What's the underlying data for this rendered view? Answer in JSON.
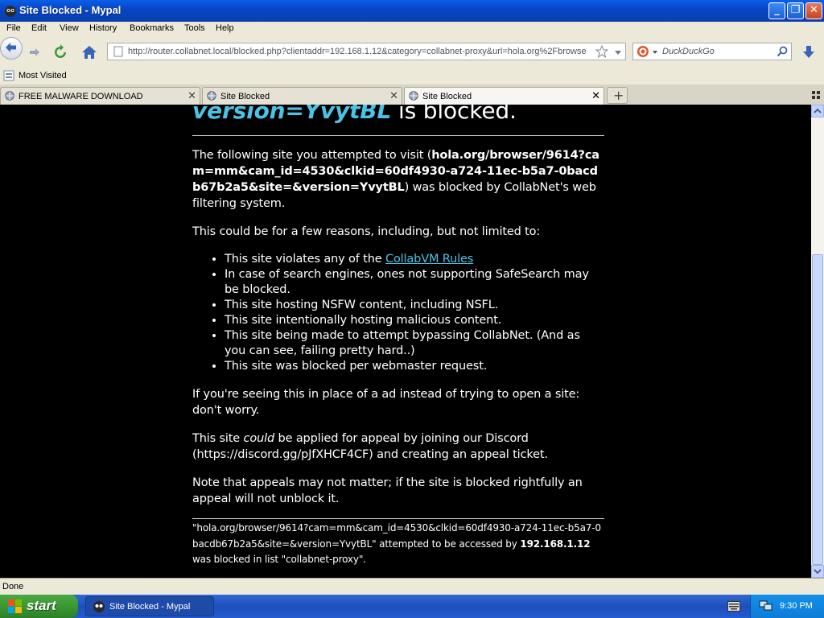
{
  "window": {
    "title": "Site Blocked - Mypal"
  },
  "caption_buttons": {
    "minimize": "_",
    "maximize": "❐",
    "close": "✕"
  },
  "menu": [
    "File",
    "Edit",
    "View",
    "History",
    "Bookmarks",
    "Tools",
    "Help"
  ],
  "nav": {
    "url": "http://router.collabnet.local/blocked.php?clientaddr=192.168.1.12&category=collabnet-proxy&url=hola.org%2Fbrowse",
    "search_placeholder": "DuckDuckGo"
  },
  "bookmarks": {
    "items": [
      "Most Visited"
    ]
  },
  "tabs": [
    {
      "label": "FREE MALWARE DOWNLOAD",
      "active": false
    },
    {
      "label": "Site Blocked",
      "active": false
    },
    {
      "label": "Site Blocked",
      "active": true
    }
  ],
  "page": {
    "heading_url": "version=YvytBL",
    "heading_rest": " is blocked.",
    "p1_before": "The following site you attempted to visit (",
    "p1_site": "hola.org/browser/9614?cam=mm&cam_id=4530&clkid=60df4930-a724-11ec-b5a7-0bacdb67b2a5&site=&version=YvytBL",
    "p1_after": ") was blocked by CollabNet's web filtering system.",
    "p2": "This could be for a few reasons, including, but not limited to:",
    "reasons": {
      "r1_before": "This site violates any of the ",
      "r1_link": "CollabVM Rules",
      "r2": "In case of search engines, ones not supporting SafeSearch may be blocked.",
      "r3": "This site hosting NSFW content, including NSFL.",
      "r4": "This site intentionally hosting malicious content.",
      "r5": "This site being made to attempt bypassing CollabNet. (And as you can see, failing pretty hard..)",
      "r6": "This site was blocked per webmaster request."
    },
    "p3": "If you're seeing this in place of a ad instead of trying to open a site: don't worry.",
    "p4_before": "This site ",
    "p4_em": "could",
    "p4_after": " be applied for appeal by joining our Discord (https://discord.gg/pJfXHCF4CF) and creating an appeal ticket.",
    "p5": "Note that appeals may not matter; if the site is blocked rightfully an appeal will not unblock it.",
    "footer_before": "\"hola.org/browser/9614?cam=mm&cam_id=4530&clkid=60df4930-a724-11ec-b5a7-0bacdb67b2a5&site=&version=YvytBL\" attempted to be accessed by ",
    "footer_ip": "192.168.1.12",
    "footer_after": " was blocked in list \"collabnet-proxy\"."
  },
  "status": {
    "text": "Done"
  },
  "taskbar": {
    "start_label": "start",
    "task_label": "Site Blocked - Mypal",
    "clock": "9:30 PM"
  }
}
